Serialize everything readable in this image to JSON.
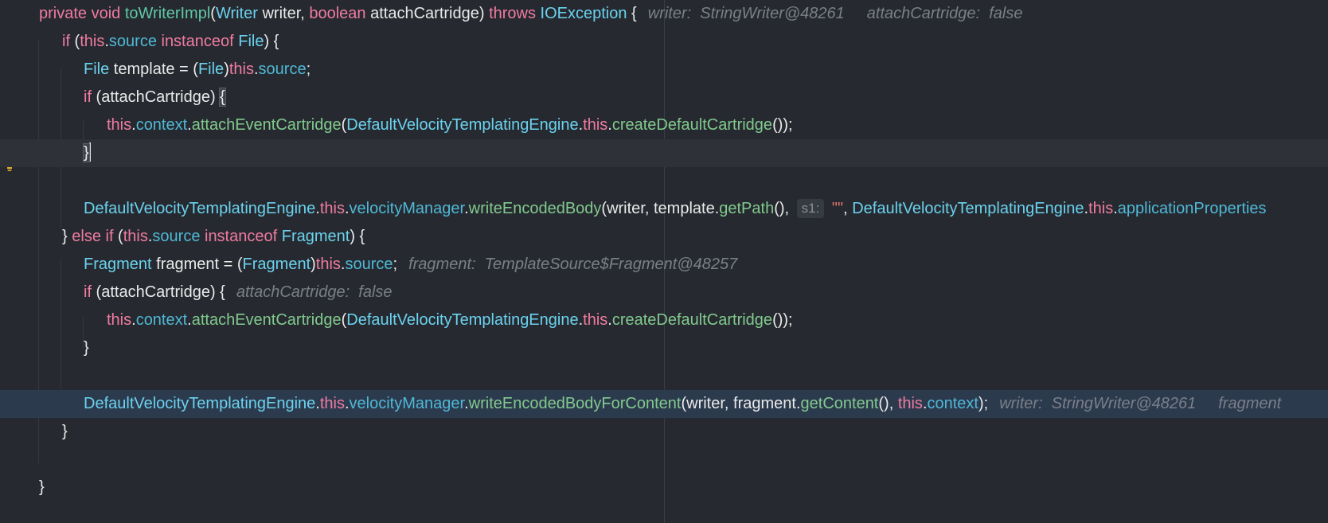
{
  "editor": {
    "lines": [
      {
        "id": "l1",
        "tokens": [
          {
            "t": "private void ",
            "c": "kw"
          },
          {
            "t": "toWriterImpl",
            "c": "fn"
          },
          {
            "t": "(",
            "c": "plain"
          },
          {
            "t": "Writer",
            "c": "type"
          },
          {
            "t": " writer, ",
            "c": "plain"
          },
          {
            "t": "boolean",
            "c": "kw"
          },
          {
            "t": " attachCartridge) ",
            "c": "plain"
          },
          {
            "t": "throws ",
            "c": "kw"
          },
          {
            "t": "IOException",
            "c": "type"
          },
          {
            "t": " {",
            "c": "plain"
          }
        ],
        "hints": [
          "writer:  StringWriter@48261",
          "attachCartridge:  false"
        ]
      },
      {
        "id": "l2",
        "tokens": [
          {
            "t": "if",
            "c": "kw"
          },
          {
            "t": " (",
            "c": "plain"
          },
          {
            "t": "this",
            "c": "kw"
          },
          {
            "t": ".",
            "c": "plain"
          },
          {
            "t": "source",
            "c": "field"
          },
          {
            "t": " instanceof ",
            "c": "kw"
          },
          {
            "t": "File",
            "c": "type"
          },
          {
            "t": ") {",
            "c": "plain"
          }
        ]
      },
      {
        "id": "l3",
        "tokens": [
          {
            "t": "File",
            "c": "type"
          },
          {
            "t": " template = (",
            "c": "plain"
          },
          {
            "t": "File",
            "c": "type"
          },
          {
            "t": ")",
            "c": "plain"
          },
          {
            "t": "this",
            "c": "kw"
          },
          {
            "t": ".",
            "c": "plain"
          },
          {
            "t": "source",
            "c": "field"
          },
          {
            "t": ";",
            "c": "plain"
          }
        ]
      },
      {
        "id": "l4",
        "tokens": [
          {
            "t": "if",
            "c": "kw"
          },
          {
            "t": " (attachCartridge) ",
            "c": "plain"
          },
          {
            "t": "{",
            "c": "plain",
            "hl": true
          }
        ]
      },
      {
        "id": "l5",
        "tokens": [
          {
            "t": "this",
            "c": "kw"
          },
          {
            "t": ".",
            "c": "plain"
          },
          {
            "t": "context",
            "c": "field"
          },
          {
            "t": ".",
            "c": "plain"
          },
          {
            "t": "attachEventCartridge",
            "c": "method"
          },
          {
            "t": "(",
            "c": "plain"
          },
          {
            "t": "DefaultVelocityTemplatingEngine",
            "c": "type"
          },
          {
            "t": ".",
            "c": "plain"
          },
          {
            "t": "this",
            "c": "kw"
          },
          {
            "t": ".",
            "c": "plain"
          },
          {
            "t": "createDefaultCartridge",
            "c": "method"
          },
          {
            "t": "());",
            "c": "plain"
          }
        ]
      },
      {
        "id": "l6",
        "tokens": [
          {
            "t": "}",
            "c": "plain",
            "hl": true
          }
        ],
        "caret": true
      },
      {
        "id": "l7",
        "tokens": []
      },
      {
        "id": "l8",
        "tokens": [
          {
            "t": "DefaultVelocityTemplatingEngine",
            "c": "type"
          },
          {
            "t": ".",
            "c": "plain"
          },
          {
            "t": "this",
            "c": "kw"
          },
          {
            "t": ".",
            "c": "plain"
          },
          {
            "t": "velocityManager",
            "c": "field"
          },
          {
            "t": ".",
            "c": "plain"
          },
          {
            "t": "writeEncodedBody",
            "c": "method"
          },
          {
            "t": "(writer, template.",
            "c": "plain"
          },
          {
            "t": "getPath",
            "c": "method"
          },
          {
            "t": "(), ",
            "c": "plain"
          },
          {
            "t": "s1:",
            "c": "param"
          },
          {
            "t": " \"\"",
            "c": "str"
          },
          {
            "t": ", ",
            "c": "plain"
          },
          {
            "t": "DefaultVelocityTemplatingEngine",
            "c": "type"
          },
          {
            "t": ".",
            "c": "plain"
          },
          {
            "t": "this",
            "c": "kw"
          },
          {
            "t": ".",
            "c": "plain"
          },
          {
            "t": "applicationProperties",
            "c": "field"
          }
        ]
      },
      {
        "id": "l9",
        "tokens": [
          {
            "t": "} ",
            "c": "plain"
          },
          {
            "t": "else if",
            "c": "kw"
          },
          {
            "t": " (",
            "c": "plain"
          },
          {
            "t": "this",
            "c": "kw"
          },
          {
            "t": ".",
            "c": "plain"
          },
          {
            "t": "source",
            "c": "field"
          },
          {
            "t": " instanceof ",
            "c": "kw"
          },
          {
            "t": "Fragment",
            "c": "type"
          },
          {
            "t": ") {",
            "c": "plain"
          }
        ]
      },
      {
        "id": "l10",
        "tokens": [
          {
            "t": "Fragment",
            "c": "type"
          },
          {
            "t": " fragment = (",
            "c": "plain"
          },
          {
            "t": "Fragment",
            "c": "type"
          },
          {
            "t": ")",
            "c": "plain"
          },
          {
            "t": "this",
            "c": "kw"
          },
          {
            "t": ".",
            "c": "plain"
          },
          {
            "t": "source",
            "c": "field"
          },
          {
            "t": ";",
            "c": "plain"
          }
        ],
        "hints": [
          "fragment:  TemplateSource$Fragment@48257"
        ]
      },
      {
        "id": "l11",
        "tokens": [
          {
            "t": "if",
            "c": "kw"
          },
          {
            "t": " (attachCartridge) {",
            "c": "plain"
          }
        ],
        "hints": [
          "attachCartridge:  false"
        ]
      },
      {
        "id": "l12",
        "tokens": [
          {
            "t": "this",
            "c": "kw"
          },
          {
            "t": ".",
            "c": "plain"
          },
          {
            "t": "context",
            "c": "field"
          },
          {
            "t": ".",
            "c": "plain"
          },
          {
            "t": "attachEventCartridge",
            "c": "method"
          },
          {
            "t": "(",
            "c": "plain"
          },
          {
            "t": "DefaultVelocityTemplatingEngine",
            "c": "type"
          },
          {
            "t": ".",
            "c": "plain"
          },
          {
            "t": "this",
            "c": "kw"
          },
          {
            "t": ".",
            "c": "plain"
          },
          {
            "t": "createDefaultCartridge",
            "c": "method"
          },
          {
            "t": "());",
            "c": "plain"
          }
        ]
      },
      {
        "id": "l13",
        "tokens": [
          {
            "t": "}",
            "c": "plain"
          }
        ]
      },
      {
        "id": "l14",
        "tokens": []
      },
      {
        "id": "l15",
        "tokens": [
          {
            "t": "DefaultVelocityTemplatingEngine",
            "c": "type"
          },
          {
            "t": ".",
            "c": "plain"
          },
          {
            "t": "this",
            "c": "kw"
          },
          {
            "t": ".",
            "c": "plain"
          },
          {
            "t": "velocityManager",
            "c": "field"
          },
          {
            "t": ".",
            "c": "plain"
          },
          {
            "t": "writeEncodedBodyForContent",
            "c": "method"
          },
          {
            "t": "(writer, fragment.",
            "c": "plain"
          },
          {
            "t": "getContent",
            "c": "method"
          },
          {
            "t": "(), ",
            "c": "plain"
          },
          {
            "t": "this",
            "c": "kw"
          },
          {
            "t": ".",
            "c": "plain"
          },
          {
            "t": "context",
            "c": "field"
          },
          {
            "t": ");",
            "c": "plain"
          }
        ],
        "hints": [
          "writer:  StringWriter@48261",
          "fragment"
        ]
      },
      {
        "id": "l16",
        "tokens": [
          {
            "t": "}",
            "c": "plain"
          }
        ]
      },
      {
        "id": "l17",
        "tokens": []
      },
      {
        "id": "l18",
        "tokens": [
          {
            "t": "}",
            "c": "plain"
          }
        ]
      }
    ]
  },
  "gutter": {
    "intention_icon": "lightbulb-icon",
    "intention_color": "#e8b231"
  },
  "colors": {
    "background": "#262a30",
    "current_line": "#2e3238",
    "execution_line": "#2c3a4e",
    "keyword": "#f07ba0",
    "type": "#6bd2ee",
    "field": "#4fb8d6",
    "method": "#82c98e",
    "hint": "#7a7f88"
  }
}
